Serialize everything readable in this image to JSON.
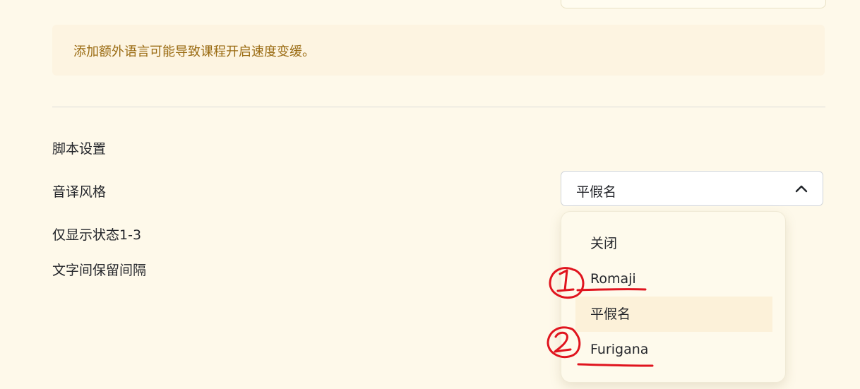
{
  "notice": {
    "text": "添加额外语言可能导致课程开启速度变缓。"
  },
  "section": {
    "title": "脚本设置"
  },
  "settings": {
    "transliteration_label": "音译风格",
    "status_label": "仅显示状态1-3",
    "spacing_label": "文字间保留间隔"
  },
  "select": {
    "value": "平假名",
    "open": true
  },
  "menu": {
    "options": [
      {
        "label": "关闭",
        "selected": false
      },
      {
        "label": "Romaji",
        "selected": false
      },
      {
        "label": "平假名",
        "selected": true
      },
      {
        "label": "Furigana",
        "selected": false
      }
    ]
  },
  "annotations": {
    "color": "#e0141e",
    "numbers": [
      "1",
      "2"
    ]
  },
  "colors": {
    "background": "#fef9ea",
    "notice_text": "#9a6b12",
    "selected_option": "#fcf1d9"
  }
}
